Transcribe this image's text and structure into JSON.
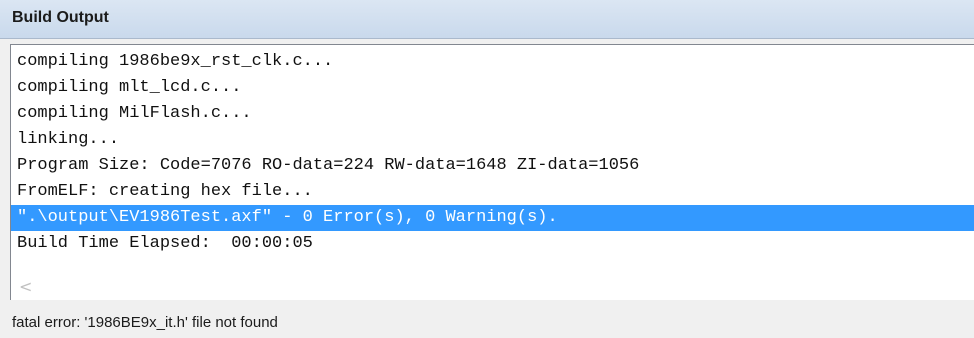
{
  "panel": {
    "title": "Build Output"
  },
  "output": {
    "lines": [
      "compiling 1986be9x_rst_clk.c...",
      "compiling mlt_lcd.c...",
      "compiling MilFlash.c...",
      "linking...",
      "Program Size: Code=7076 RO-data=224 RW-data=1648 ZI-data=1056",
      "FromELF: creating hex file...",
      "\".\\output\\EV1986Test.axf\" - 0 Error(s), 0 Warning(s).",
      "Build Time Elapsed:  00:00:05"
    ],
    "selected_line_index": 6
  },
  "scrollbar": {
    "left_arrow_icon": "chevron-left-icon",
    "left_arrow_glyph": "<"
  },
  "status": {
    "message": "fatal error: '1986BE9x_it.h' file not found"
  },
  "colors": {
    "selection": "#3399ff",
    "title_bar": "#c9d9ec"
  }
}
